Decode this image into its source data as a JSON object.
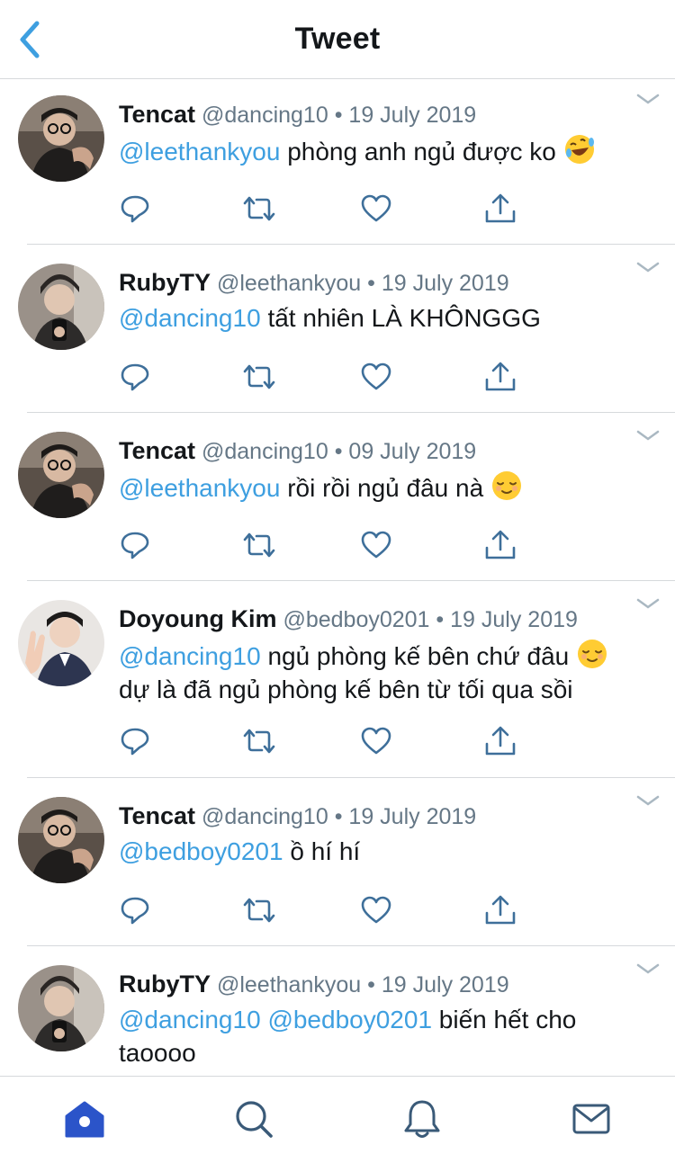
{
  "header": {
    "title": "Tweet",
    "back_icon": "chevron-left-icon",
    "accent": "#3e9fe0"
  },
  "colors": {
    "mention": "#3e9fe0",
    "meta": "#657786",
    "text": "#14171a",
    "divider": "#d6d9dc",
    "home_active": "#2b54c9"
  },
  "tweets": [
    {
      "name": "Tencat",
      "handle": "@dancing10",
      "dot": "•",
      "date": "19 July 2019",
      "mentions": [
        "@leethankyou"
      ],
      "text": "phòng anh ngủ được ko",
      "emoji": "rolling-laughing-emoji"
    },
    {
      "name": "RubyTY",
      "handle": "@leethankyou",
      "dot": "•",
      "date": "19 July 2019",
      "mentions": [
        "@dancing10"
      ],
      "text": "tất nhiên LÀ KHÔNGGG",
      "emoji": ""
    },
    {
      "name": "Tencat",
      "handle": "@dancing10",
      "dot": "•",
      "date": "09 July 2019",
      "mentions": [
        "@leethankyou"
      ],
      "text": "rồi rồi ngủ đâu nà",
      "emoji": "relieved-face-emoji"
    },
    {
      "name": "Doyoung Kim",
      "handle": "@bedboy0201",
      "dot": "•",
      "date": "19 July 2019",
      "mentions": [
        "@dancing10"
      ],
      "text": "ngủ phòng kế bên chứ đâu",
      "emoji": "relieved-face-emoji",
      "text2": "dự là đã ngủ phòng kế bên từ tối qua sồi"
    },
    {
      "name": "Tencat",
      "handle": "@dancing10",
      "dot": "•",
      "date": "19 July 2019",
      "mentions": [
        "@bedboy0201"
      ],
      "text": "ồ hí hí",
      "emoji": ""
    },
    {
      "name": "RubyTY",
      "handle": "@leethankyou",
      "dot": "•",
      "date": "19 July 2019",
      "mentions": [
        "@dancing10",
        "@bedboy0201"
      ],
      "text": "biến hết cho",
      "emoji": "",
      "text2": "taoooo"
    }
  ],
  "action_icons": [
    "reply-icon",
    "retweet-icon",
    "like-icon",
    "share-icon"
  ],
  "tabbar": [
    {
      "icon": "home-icon",
      "active": true
    },
    {
      "icon": "search-icon",
      "active": false
    },
    {
      "icon": "notifications-icon",
      "active": false
    },
    {
      "icon": "messages-icon",
      "active": false
    }
  ]
}
